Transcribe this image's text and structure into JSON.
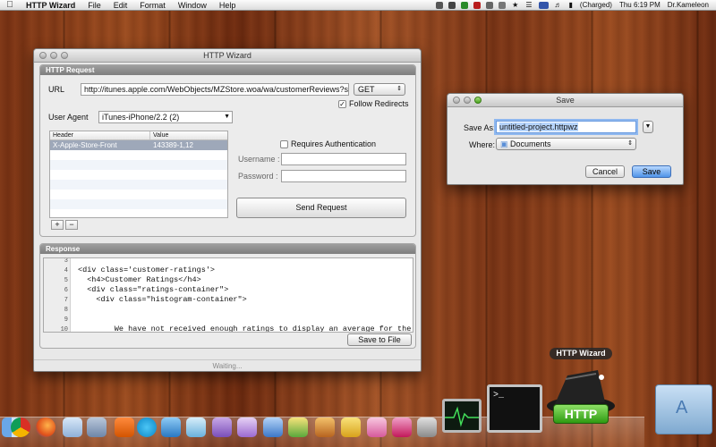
{
  "menubar": {
    "app_name": "HTTP Wizard",
    "menus": [
      "File",
      "Edit",
      "Format",
      "Window",
      "Help"
    ],
    "battery": "(Charged)",
    "clock": "Thu 6:19 PM",
    "user": "Dr.Kameleon"
  },
  "main_window": {
    "title": "HTTP Wizard",
    "request_section": "HTTP Request",
    "url_label": "URL",
    "url_value": "http://itunes.apple.com/WebObjects/MZStore.woa/wa/customerReviews?s",
    "method": "GET",
    "follow_redirects": "Follow Redirects",
    "user_agent_label": "User Agent",
    "user_agent_value": "iTunes-iPhone/2.2 (2)",
    "headers_table": {
      "columns": [
        "Header",
        "Value"
      ],
      "rows": [
        [
          "X-Apple-Store-Front",
          "143389-1,12"
        ]
      ]
    },
    "add_btn": "+",
    "remove_btn": "−",
    "requires_auth": "Requires Authentication",
    "username_label": "Username :",
    "password_label": "Password :",
    "send_request": "Send Request",
    "response_section": "Response",
    "response_lines": [
      {
        "n": "3",
        "t": ""
      },
      {
        "n": "4",
        "t": "<div class='customer-ratings'>"
      },
      {
        "n": "5",
        "t": "  <h4>Customer Ratings</h4>"
      },
      {
        "n": "6",
        "t": "  <div class=\"ratings-container\">"
      },
      {
        "n": "7",
        "t": "    <div class=\"histogram-container\">"
      },
      {
        "n": "8",
        "t": ""
      },
      {
        "n": "9",
        "t": ""
      },
      {
        "n": "10",
        "t": "        We have not received enough ratings to display an average for the"
      }
    ],
    "save_to_file": "Save to File",
    "status": "Waiting..."
  },
  "save_dialog": {
    "title": "Save",
    "save_as_label": "Save As:",
    "save_as_value": "untitled-project.httpwz",
    "where_label": "Where:",
    "where_value": "Documents",
    "cancel": "Cancel",
    "save": "Save"
  },
  "dock": {
    "tooltip": "HTTP Wizard",
    "http_label": "HTTP"
  }
}
